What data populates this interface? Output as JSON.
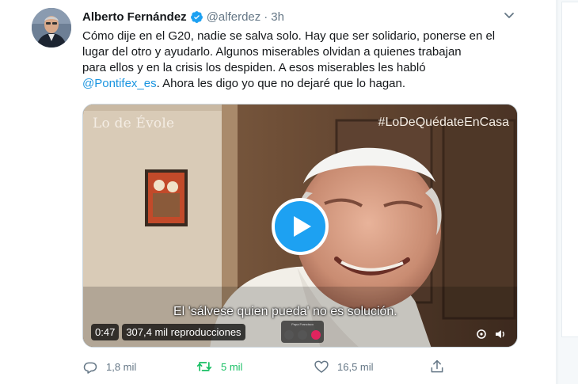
{
  "tweet": {
    "author_name": "Alberto Fernández",
    "handle": "@alferdez",
    "separator": "·",
    "time": "3h",
    "text_lines": [
      "Cómo dije en el G20, nadie se salva solo. Hay que ser solidario, ponerse en el",
      "lugar del otro y ayudarlo. Algunos miserables olvidan a quienes trabajan",
      "para ellos y en la crisis los despiden. A esos miserables les habló"
    ],
    "mention": "@Pontifex_es",
    "text_tail": ". Ahora les digo yo que no dejaré que lo hagan."
  },
  "media": {
    "brand": "Lo de Évole",
    "hashtag": "#LoDeQuédateEnCasa",
    "subtitle": "El 'sálvese quien pueda' no es solución.",
    "duration": "0:47",
    "views": "307,4 mil reproducciones",
    "call_title": "Papa Francisco"
  },
  "actions": {
    "replies": "1,8 mil",
    "retweets": "5 mil",
    "likes": "16,5 mil"
  },
  "colors": {
    "accent": "#1da1f2",
    "retweet_active": "#17bf63",
    "secondary_text": "#657786",
    "link": "#1b95e0"
  },
  "icons": [
    "verified-badge-icon",
    "chevron-down-icon",
    "play-icon",
    "reply-icon",
    "retweet-icon",
    "like-icon",
    "share-icon"
  ]
}
